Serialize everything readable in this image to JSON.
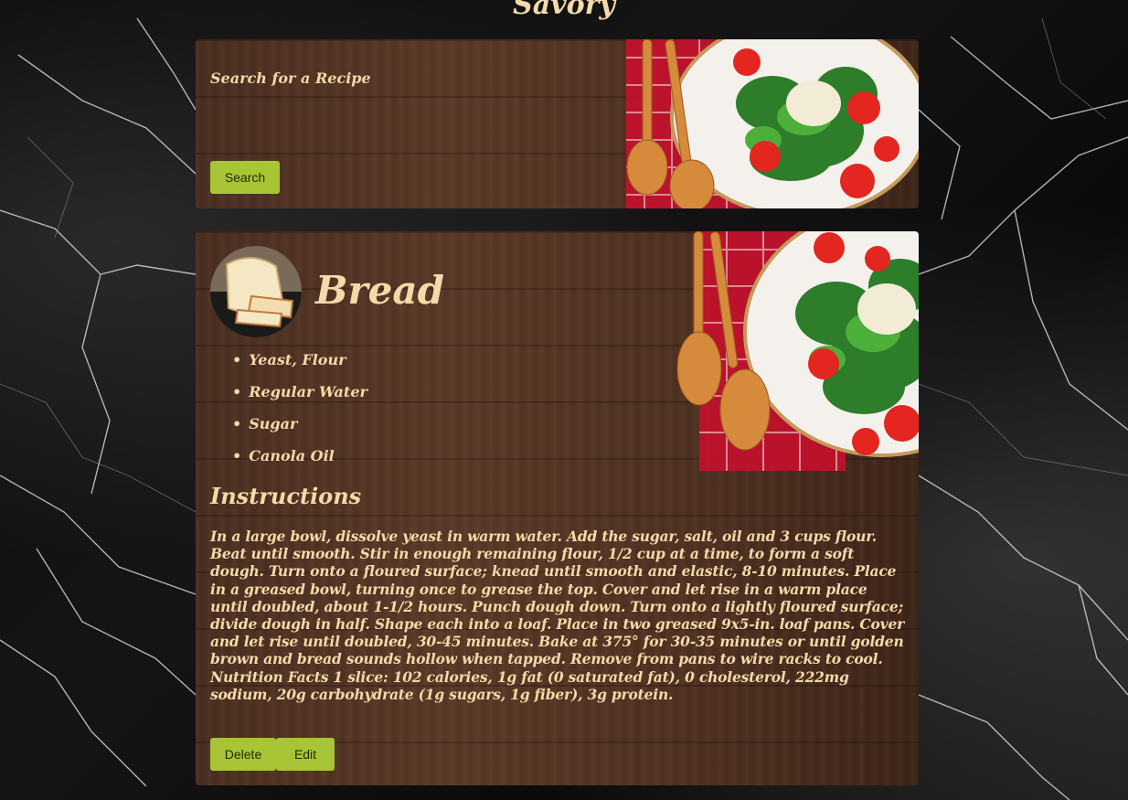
{
  "header": {
    "site_title": "Savory"
  },
  "search": {
    "label": "Search for a Recipe",
    "button_label": "Search"
  },
  "recipe": {
    "title": "Bread",
    "ingredients": [
      "Yeast, Flour",
      "Regular Water",
      "Sugar",
      "Canola Oil"
    ],
    "instructions_heading": "Instructions",
    "instructions": "In a large bowl, dissolve yeast in warm water. Add the sugar, salt, oil and 3 cups flour. Beat until smooth. Stir in enough remaining flour, 1/2 cup at a time, to form a soft dough. Turn onto a floured surface; knead until smooth and elastic, 8-10 minutes. Place in a greased bowl, turning once to grease the top. Cover and let rise in a warm place until doubled, about 1-1/2 hours. Punch dough down. Turn onto a lightly floured surface; divide dough in half. Shape each into a loaf. Place in two greased 9x5-in. loaf pans. Cover and let rise until doubled, 30-45 minutes. Bake at 375° for 30-35 minutes or until golden brown and bread sounds hollow when tapped. Remove from pans to wire racks to cool. Nutrition Facts 1 slice: 102 calories, 1g fat (0 saturated fat), 0 cholesterol, 222mg sodium, 20g carbohydrate (1g sugars, 1g fiber), 3g protein.",
    "delete_label": "Delete",
    "edit_label": "Edit"
  },
  "colors": {
    "accent_button": "#a7c534",
    "title_text": "#f5d9a8",
    "wood": "#4a2e20"
  }
}
